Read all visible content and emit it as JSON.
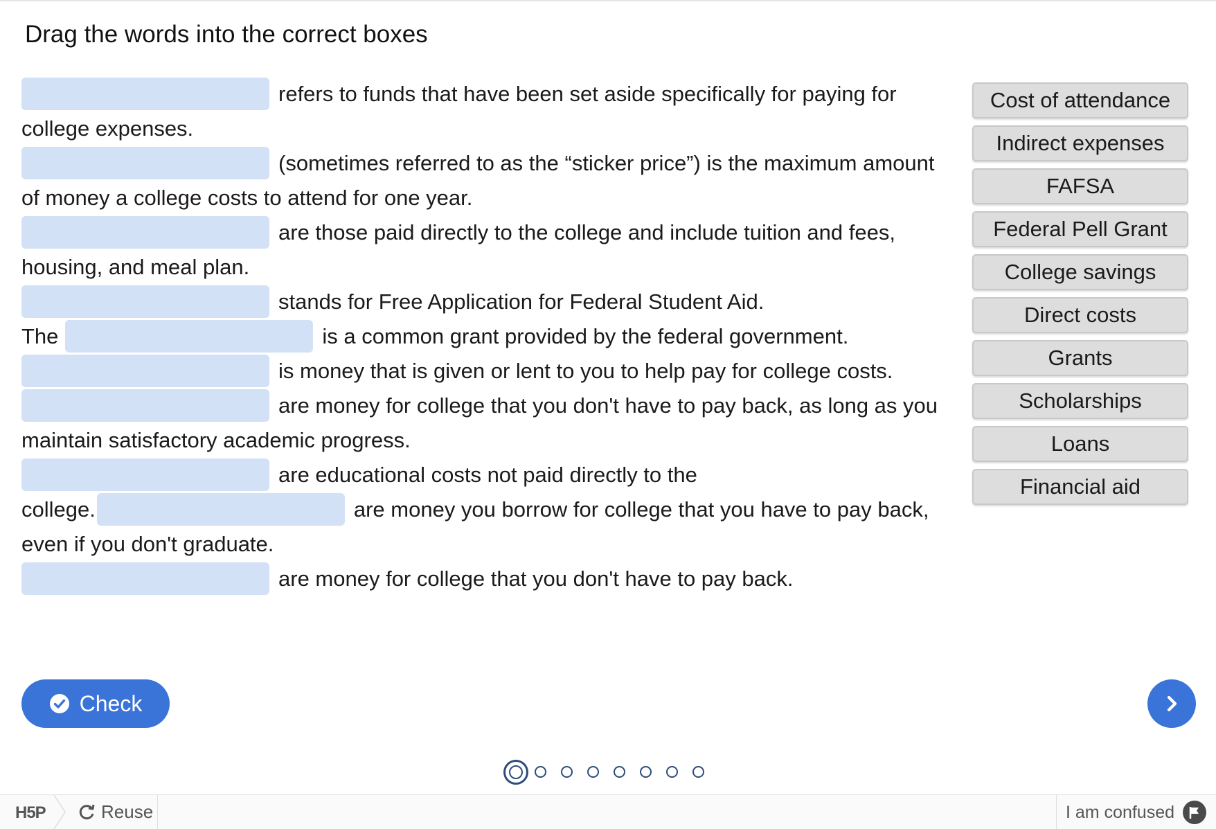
{
  "title": "Drag the words into the correct boxes",
  "sentences": {
    "s1a": "refers to funds that have been set aside specifically for paying for",
    "s1b": "college expenses.",
    "s2a": "(sometimes referred to as the “sticker price”) is the maximum amount",
    "s2b": "of money a college costs to attend for one year.",
    "s3a": "are those paid directly to the college and include tuition and fees,",
    "s3b": "housing, and meal plan.",
    "s4": "stands for Free Application for Federal Student Aid.",
    "s5_pre": "The",
    "s5_post": "is a common grant provided by the federal government.",
    "s6": "is money that is given or lent to you to help pay for college costs.",
    "s7a": "are money for college that you don't have to pay back, as long as you",
    "s7b": "maintain satisfactory academic progress.",
    "s8a": "are educational costs not paid directly to the",
    "s8b_pre": "college.",
    "s9a": "are money you borrow for college that you have to pay back,",
    "s9b": "even if you don't graduate.",
    "s10": "are money for college that you don't have to pay back."
  },
  "words": [
    "Cost of attendance",
    "Indirect expenses",
    "FAFSA",
    "Federal Pell Grant",
    "College savings",
    "Direct costs",
    "Grants",
    "Scholarships",
    "Loans",
    "Financial aid"
  ],
  "buttons": {
    "check": "Check"
  },
  "footer": {
    "logo": "H5P",
    "reuse": "Reuse",
    "confused": "I am confused"
  },
  "progress": {
    "current": 1,
    "total": 8
  },
  "colors": {
    "accent": "#3a74d8",
    "dropzone": "#d2e1f5",
    "word_bg": "#dddddd",
    "dot": "#2d4b7d"
  }
}
